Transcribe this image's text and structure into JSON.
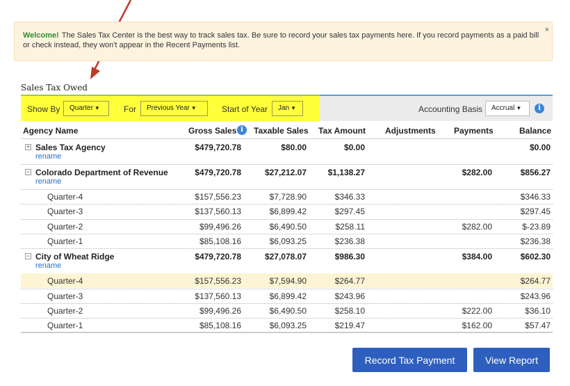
{
  "banner": {
    "welcome": "Welcome!",
    "message": "The Sales Tax Center is the best way to track sales tax. Be sure to record your sales tax payments here. If you record payments as a paid bill or check instead, they won't appear in the Recent Payments list.",
    "close": "×"
  },
  "section_title": "Sales Tax Owed",
  "filters": {
    "show_by_label": "Show By",
    "show_by_value": "Quarter",
    "for_label": "For",
    "for_value": "Previous Year",
    "start_label": "Start of Year",
    "start_value": "Jan",
    "basis_label": "Accounting Basis",
    "basis_value": "Accrual"
  },
  "columns": {
    "agency": "Agency Name",
    "gross": "Gross Sales",
    "taxable": "Taxable Sales",
    "tax": "Tax Amount",
    "adjustments": "Adjustments",
    "payments": "Payments",
    "balance": "Balance"
  },
  "agencies": [
    {
      "name": "Sales Tax Agency",
      "rename": "rename",
      "expander": "+",
      "gross": "$479,720.78",
      "taxable": "$80.00",
      "tax": "$0.00",
      "adjustments": "",
      "payments": "",
      "balance": "$0.00",
      "rows": []
    },
    {
      "name": "Colorado Department of Revenue",
      "rename": "rename",
      "expander": "−",
      "gross": "$479,720.78",
      "taxable": "$27,212.07",
      "tax": "$1,138.27",
      "adjustments": "",
      "payments": "$282.00",
      "balance": "$856.27",
      "rows": [
        {
          "label": "Quarter-4",
          "gross": "$157,556.23",
          "taxable": "$7,728.90",
          "tax": "$346.33",
          "payments": "",
          "balance": "$346.33"
        },
        {
          "label": "Quarter-3",
          "gross": "$137,560.13",
          "taxable": "$6,899.42",
          "tax": "$297.45",
          "payments": "",
          "balance": "$297.45"
        },
        {
          "label": "Quarter-2",
          "gross": "$99,496.26",
          "taxable": "$6,490.50",
          "tax": "$258.11",
          "payments": "$282.00",
          "balance": "$-23.89"
        },
        {
          "label": "Quarter-1",
          "gross": "$85,108.16",
          "taxable": "$6,093.25",
          "tax": "$236.38",
          "payments": "",
          "balance": "$236.38"
        }
      ]
    },
    {
      "name": "City of Wheat Ridge",
      "rename": "rename",
      "expander": "−",
      "gross": "$479,720.78",
      "taxable": "$27,078.07",
      "tax": "$986.30",
      "adjustments": "",
      "payments": "$384.00",
      "balance": "$602.30",
      "rows": [
        {
          "label": "Quarter-4",
          "gross": "$157,556.23",
          "taxable": "$7,594.90",
          "tax": "$264.77",
          "payments": "",
          "balance": "$264.77",
          "highlight": true
        },
        {
          "label": "Quarter-3",
          "gross": "$137,560.13",
          "taxable": "$6,899.42",
          "tax": "$243.96",
          "payments": "",
          "balance": "$243.96"
        },
        {
          "label": "Quarter-2",
          "gross": "$99,496.26",
          "taxable": "$6,490.50",
          "tax": "$258.10",
          "payments": "$222.00",
          "balance": "$36.10"
        },
        {
          "label": "Quarter-1",
          "gross": "$85,108.16",
          "taxable": "$6,093.25",
          "tax": "$219.47",
          "payments": "$162.00",
          "balance": "$57.47"
        }
      ]
    }
  ],
  "buttons": {
    "record": "Record Tax Payment",
    "view": "View Report"
  },
  "colors": {
    "highlight_yellow": "#ffff3a",
    "row_highlight": "#fdf4d4",
    "button_blue": "#2f5fbe",
    "link_blue": "#2a6fc9",
    "arrow_red": "#c0392b"
  },
  "icons": {
    "info": "info-circle-icon",
    "expand": "plus-box-icon",
    "collapse": "minus-box-icon",
    "dropdown": "caret-down-icon",
    "annotation": "red-arrow-icon"
  }
}
